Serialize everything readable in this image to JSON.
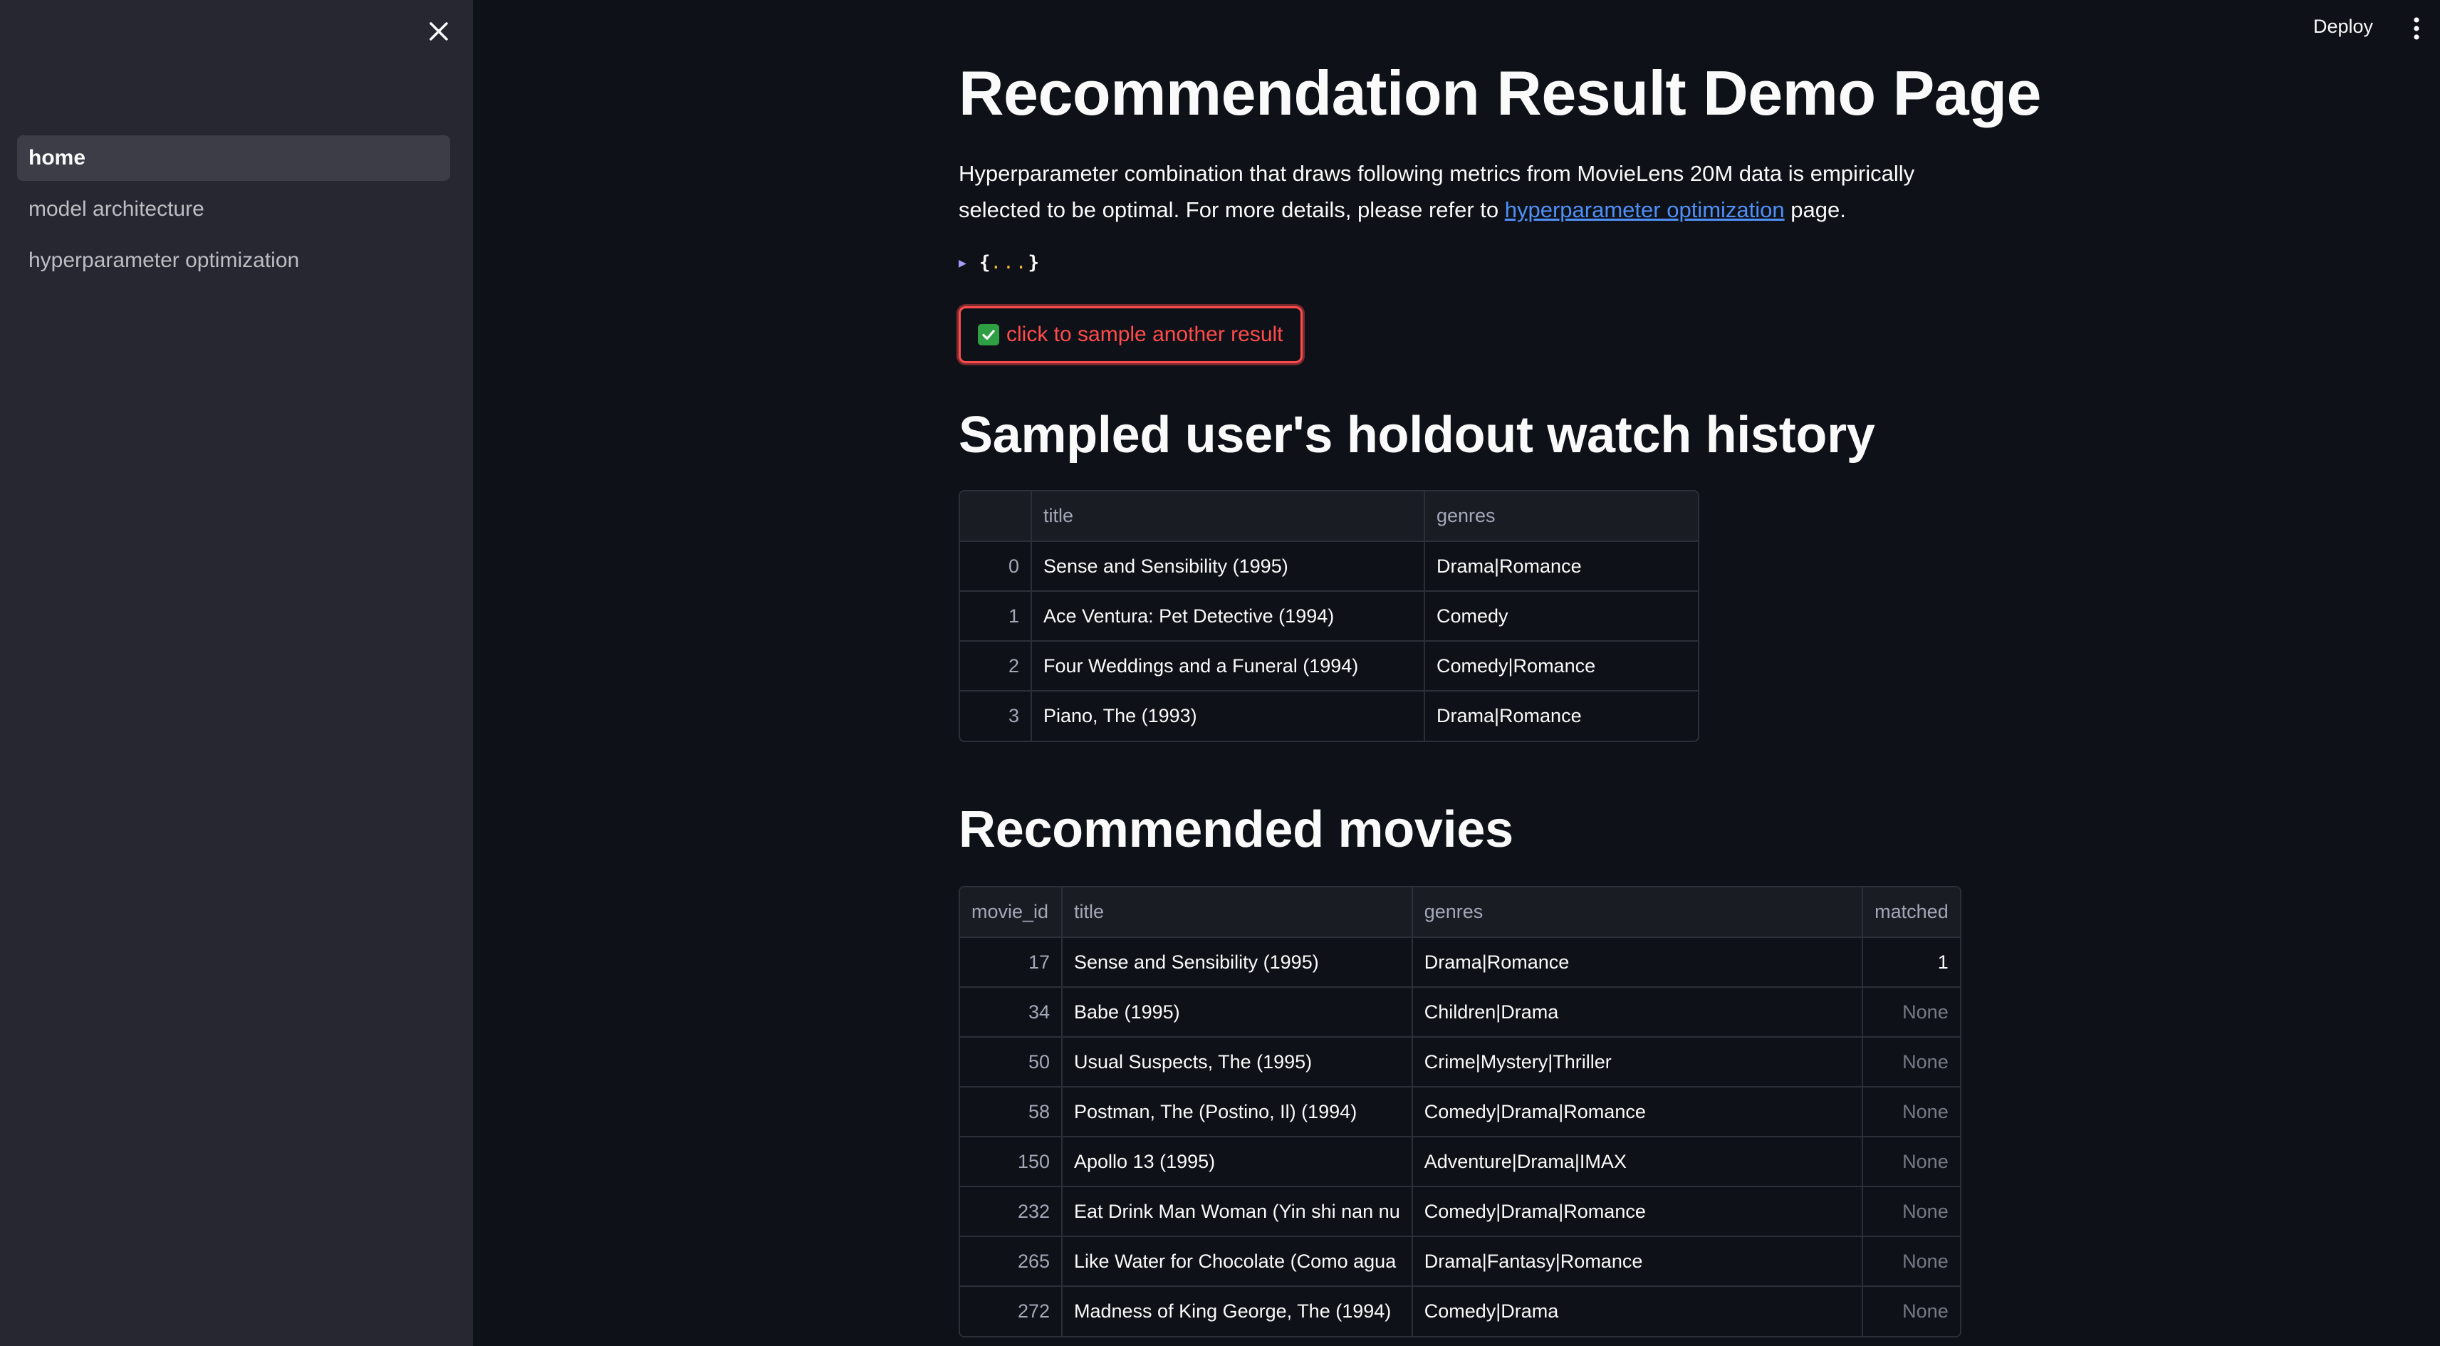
{
  "sidebar": {
    "items": [
      {
        "label": "home",
        "active": true
      },
      {
        "label": "model architecture",
        "active": false
      },
      {
        "label": "hyperparameter optimization",
        "active": false
      }
    ],
    "close_icon": "close-icon"
  },
  "header": {
    "deploy_label": "Deploy",
    "menu_icon": "kebab-menu-icon"
  },
  "main": {
    "title": "Recommendation Result Demo Page",
    "intro_text_1": "Hyperparameter combination that draws following metrics from MovieLens 20M data is empirically selected to be optimal. For more details, please refer to ",
    "intro_link": "hyperparameter optimization",
    "intro_text_2": " page.",
    "json_open": "{",
    "json_dots": "...",
    "json_close": "}",
    "sample_button_label": "click to sample another result",
    "holdout_heading": "Sampled user's holdout watch history",
    "recommended_heading": "Recommended movies"
  },
  "accent_colors": {
    "primary": "#ff4b4b",
    "link": "#4f8ff7",
    "sidebar_bg": "#262730",
    "page_bg": "#0e1117"
  },
  "holdout_table": {
    "columns": [
      "",
      "title",
      "genres"
    ],
    "rows": [
      {
        "idx": "0",
        "title": "Sense and Sensibility (1995)",
        "genres": "Drama|Romance"
      },
      {
        "idx": "1",
        "title": "Ace Ventura: Pet Detective (1994)",
        "genres": "Comedy"
      },
      {
        "idx": "2",
        "title": "Four Weddings and a Funeral (1994)",
        "genres": "Comedy|Romance"
      },
      {
        "idx": "3",
        "title": "Piano, The (1993)",
        "genres": "Drama|Romance"
      }
    ]
  },
  "recommended_table": {
    "columns": [
      "movie_id",
      "title",
      "genres",
      "matched"
    ],
    "rows": [
      {
        "movie_id": "17",
        "title": "Sense and Sensibility (1995)",
        "genres": "Drama|Romance",
        "matched": "1"
      },
      {
        "movie_id": "34",
        "title": "Babe (1995)",
        "genres": "Children|Drama",
        "matched": "None"
      },
      {
        "movie_id": "50",
        "title": "Usual Suspects, The (1995)",
        "genres": "Crime|Mystery|Thriller",
        "matched": "None"
      },
      {
        "movie_id": "58",
        "title": "Postman, The (Postino, Il) (1994)",
        "genres": "Comedy|Drama|Romance",
        "matched": "None"
      },
      {
        "movie_id": "150",
        "title": "Apollo 13 (1995)",
        "genres": "Adventure|Drama|IMAX",
        "matched": "None"
      },
      {
        "movie_id": "232",
        "title": "Eat Drink Man Woman (Yin shi nan nu",
        "genres": "Comedy|Drama|Romance",
        "matched": "None"
      },
      {
        "movie_id": "265",
        "title": "Like Water for Chocolate (Como agua",
        "genres": "Drama|Fantasy|Romance",
        "matched": "None"
      },
      {
        "movie_id": "272",
        "title": "Madness of King George, The (1994)",
        "genres": "Comedy|Drama",
        "matched": "None"
      }
    ]
  }
}
